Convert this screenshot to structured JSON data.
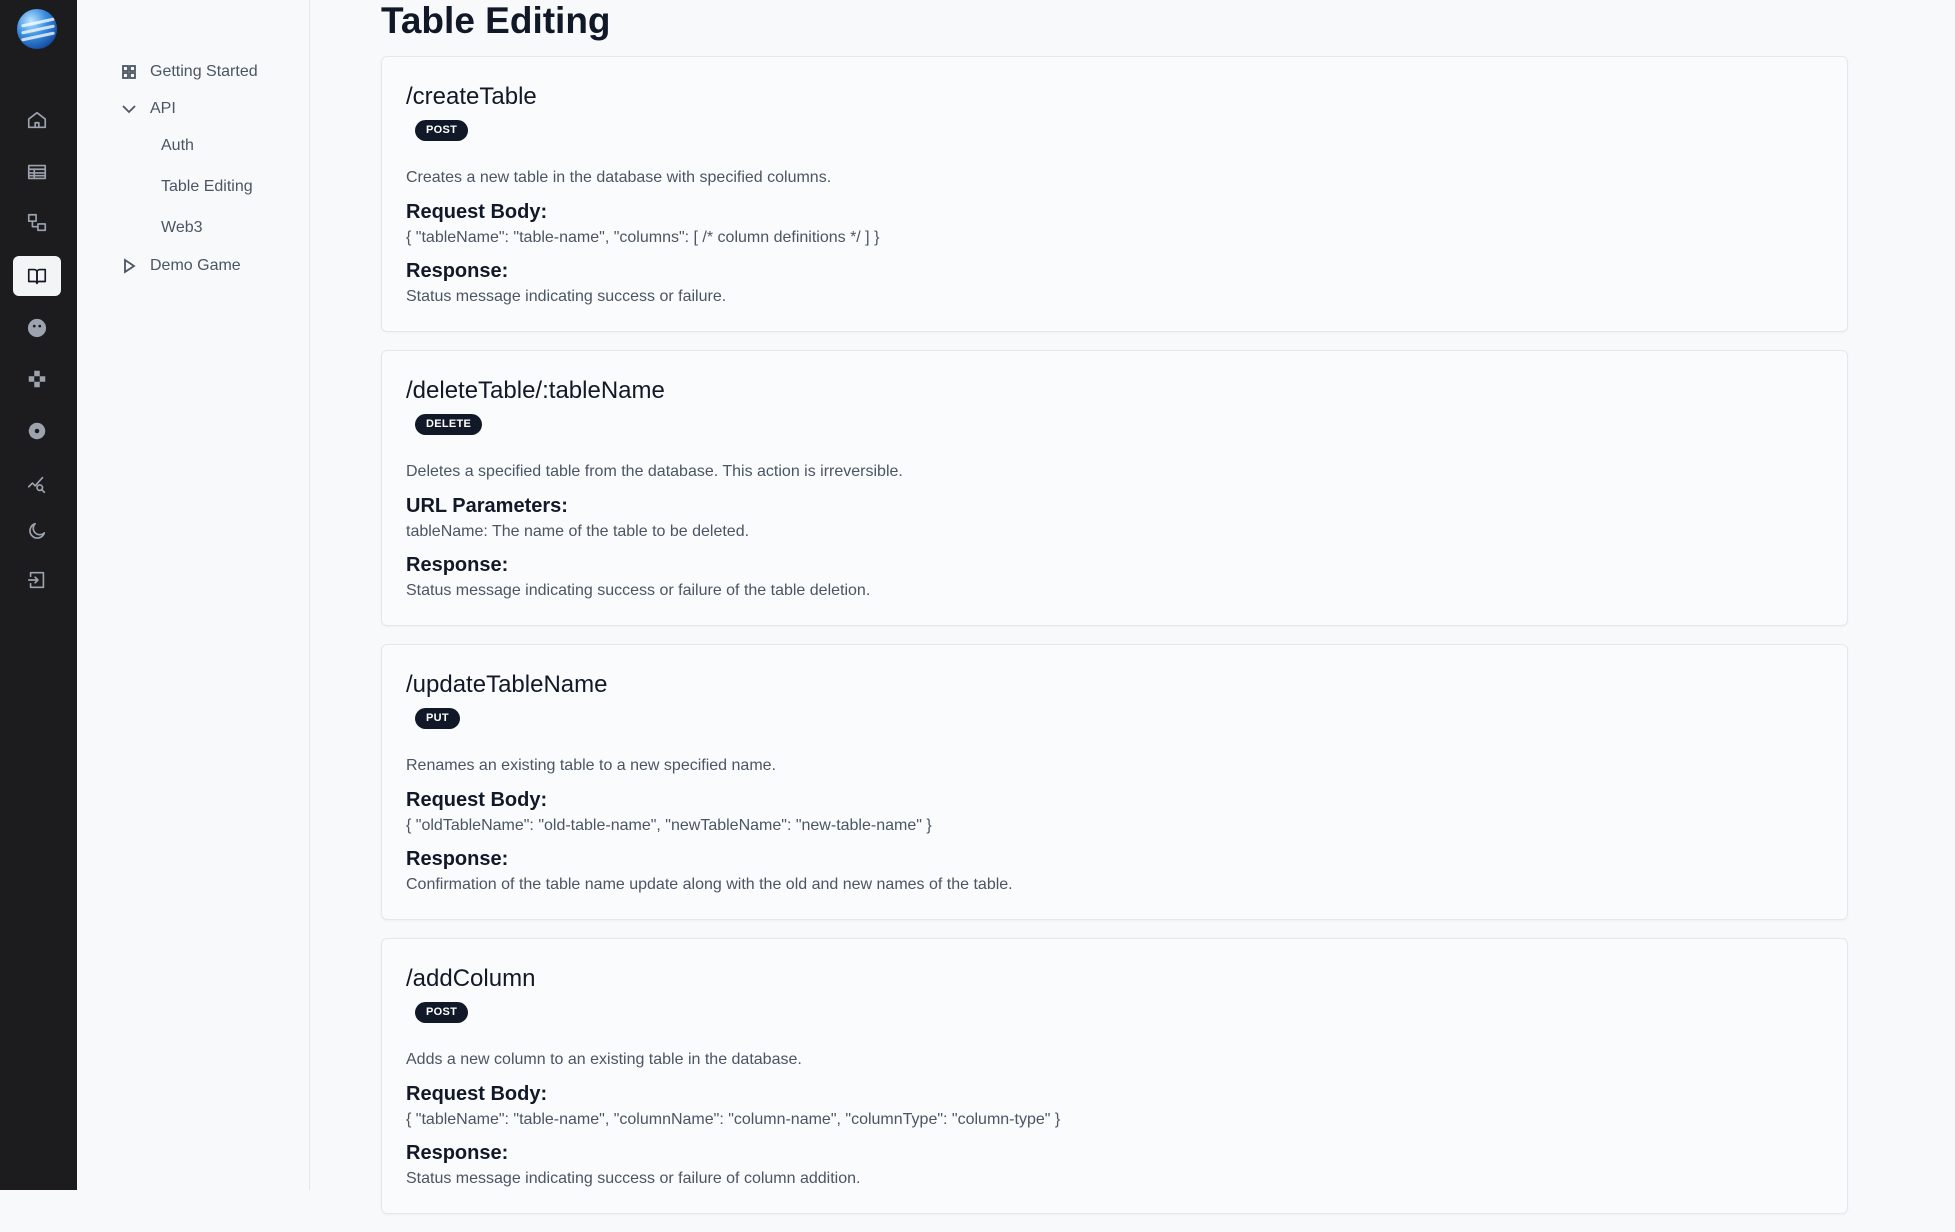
{
  "rail": {
    "items": [
      {
        "icon": "home-icon"
      },
      {
        "icon": "table-icon"
      },
      {
        "icon": "workflow-icon"
      },
      {
        "icon": "book-icon",
        "active": true
      },
      {
        "icon": "community-icon"
      },
      {
        "icon": "gamepad-icon"
      },
      {
        "icon": "gear-icon"
      },
      {
        "icon": "analytics-icon"
      },
      {
        "icon": "moon-icon"
      },
      {
        "icon": "logout-icon"
      }
    ]
  },
  "sidebar": {
    "getting_started": "Getting Started",
    "api": "API",
    "api_children": [
      "Auth",
      "Table Editing",
      "Web3"
    ],
    "demo_game": "Demo Game"
  },
  "page": {
    "title": "Table Editing"
  },
  "endpoints": [
    {
      "path": "/createTable",
      "method": "POST",
      "description": "Creates a new table in the database with specified columns.",
      "section1_title": "Request Body:",
      "section1_body": "{ \"tableName\": \"table-name\", \"columns\": [ /* column definitions */ ] }",
      "section2_title": "Response:",
      "section2_body": "Status message indicating success or failure."
    },
    {
      "path": "/deleteTable/:tableName",
      "method": "DELETE",
      "description": "Deletes a specified table from the database. This action is irreversible.",
      "section1_title": "URL Parameters:",
      "section1_body": "tableName: The name of the table to be deleted.",
      "section2_title": "Response:",
      "section2_body": "Status message indicating success or failure of the table deletion."
    },
    {
      "path": "/updateTableName",
      "method": "PUT",
      "description": "Renames an existing table to a new specified name.",
      "section1_title": "Request Body:",
      "section1_body": "{ \"oldTableName\": \"old-table-name\", \"newTableName\": \"new-table-name\" }",
      "section2_title": "Response:",
      "section2_body": "Confirmation of the table name update along with the old and new names of the table."
    },
    {
      "path": "/addColumn",
      "method": "POST",
      "description": "Adds a new column to an existing table in the database.",
      "section1_title": "Request Body:",
      "section1_body": "{ \"tableName\": \"table-name\", \"columnName\": \"column-name\", \"columnType\": \"column-type\" }",
      "section2_title": "Response:",
      "section2_body": "Status message indicating success or failure of column addition."
    }
  ]
}
